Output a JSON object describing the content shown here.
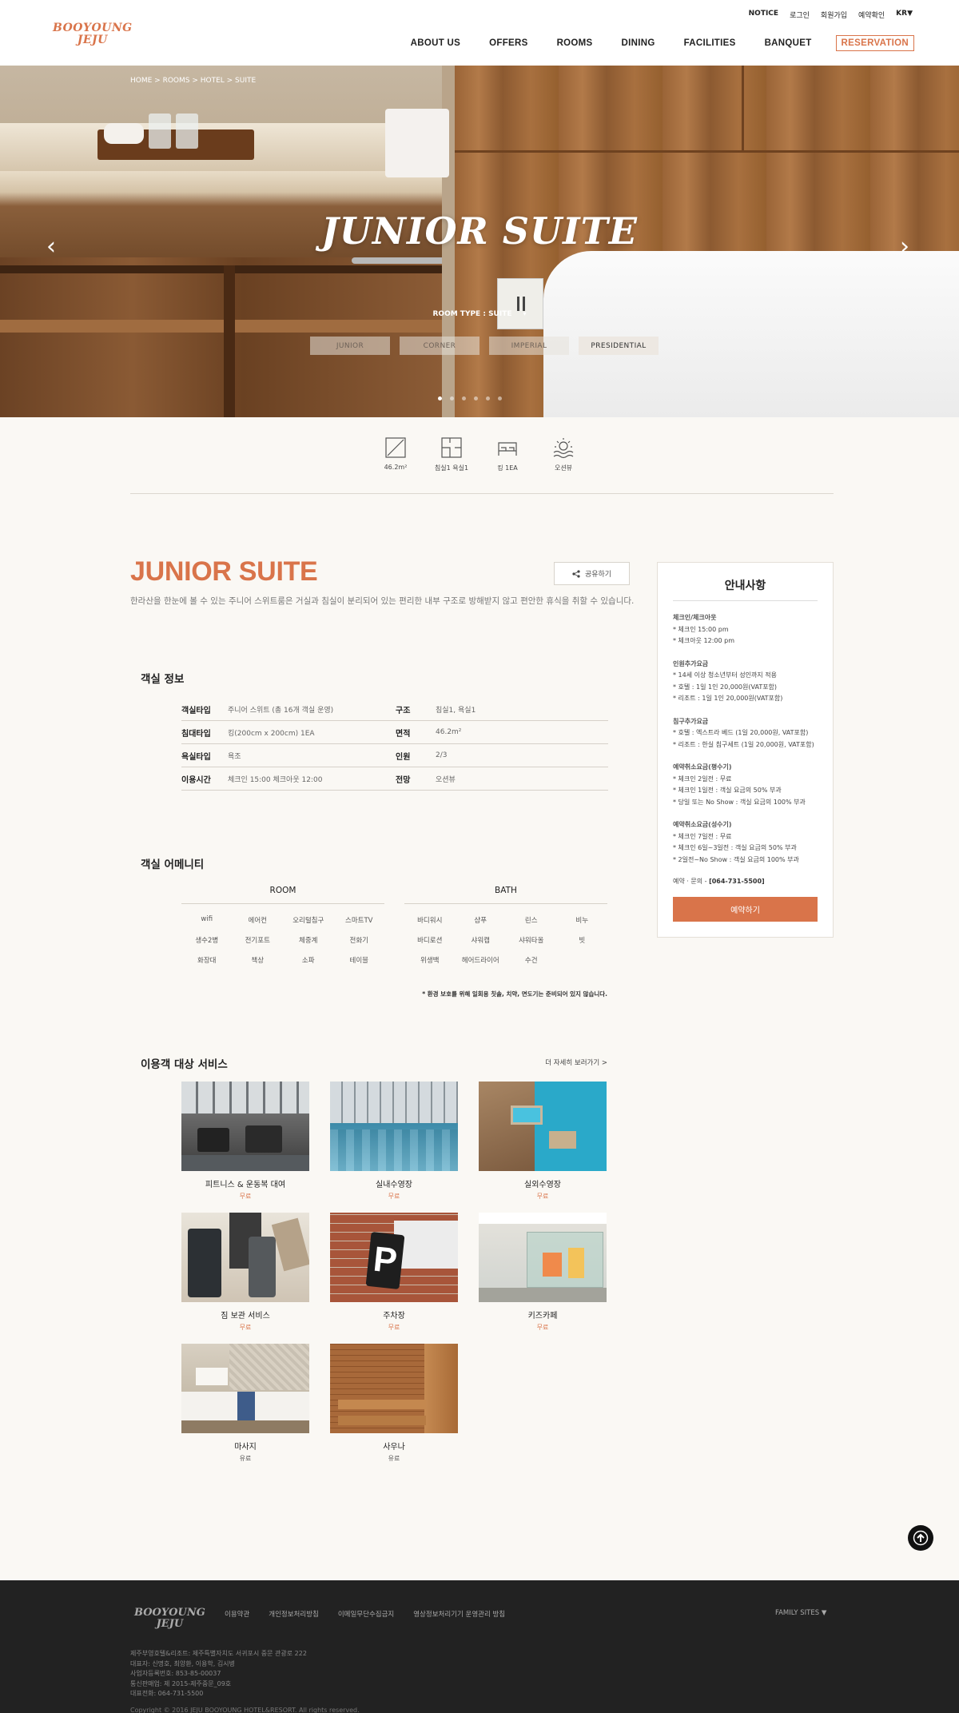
{
  "header": {
    "logo_line1": "BOOYOUNG",
    "logo_line2": "JEJU",
    "top_links": [
      "NOTICE",
      "로그인",
      "회원가입",
      "예약확인"
    ],
    "lang": "KR",
    "nav": [
      "ABOUT US",
      "OFFERS",
      "ROOMS",
      "DINING",
      "FACILITIES",
      "BANQUET"
    ],
    "reservation": "RESERVATION"
  },
  "hero": {
    "breadcrumb": "HOME > ROOMS > HOTEL > SUITE",
    "title": "JUNIOR SUITE",
    "room_type": "ROOM TYPE : SUITE",
    "tabs": [
      "JUNIOR",
      "CORNER",
      "IMPERIAL",
      "PRESIDENTIAL"
    ],
    "active_tab": "PRESIDENTIAL",
    "slide_count": 6,
    "active_slide": 1
  },
  "features": [
    {
      "icon": "area-icon",
      "label": "46.2m²"
    },
    {
      "icon": "floorplan-icon",
      "label": "침실1 욕실1"
    },
    {
      "icon": "bed-icon",
      "label": "킹 1EA"
    },
    {
      "icon": "ocean-view-icon",
      "label": "오션뷰"
    }
  ],
  "room": {
    "title": "JUNIOR SUITE",
    "description": "한라산을 한눈에 볼 수 있는 주니어 스위트룸은 거실과 침실이 분리되어 있는 편리한 내부 구조로 방해받지 않고 편안한 휴식을 취할 수 있습니다.",
    "share": "공유하기"
  },
  "room_info": {
    "title": "객실 정보",
    "rows": [
      {
        "k1": "객실타입",
        "v1": "주니어 스위트 (총 16개 객실 운영)",
        "k2": "구조",
        "v2": "침실1, 욕실1"
      },
      {
        "k1": "침대타입",
        "v1": "킹(200cm x 200cm) 1EA",
        "k2": "면적",
        "v2": "46.2m²"
      },
      {
        "k1": "욕실타입",
        "v1": "욕조",
        "k2": "인원",
        "v2": "2/3"
      },
      {
        "k1": "이용시간",
        "v1": "체크인 15:00 체크아웃 12:00",
        "k2": "전망",
        "v2": "오션뷰"
      }
    ]
  },
  "amenity": {
    "title": "객실 어메니티",
    "room_head": "ROOM",
    "room_items": [
      "wifi",
      "에어컨",
      "오리털침구",
      "스마트TV",
      "생수2병",
      "전기포트",
      "체중계",
      "전화기",
      "화장대",
      "책상",
      "소파",
      "테이블"
    ],
    "bath_head": "BATH",
    "bath_items": [
      "바디워시",
      "샴푸",
      "린스",
      "비누",
      "바디로션",
      "샤워캡",
      "샤워타올",
      "빗",
      "위생백",
      "헤어드라이어",
      "수건"
    ],
    "note": "* 환경 보호를 위해 일회용 칫솔, 치약, 면도기는 준비되어 있지 않습니다."
  },
  "services": {
    "title": "이용객 대상 서비스",
    "more": "더 자세히 보러가기 >",
    "items": [
      {
        "name": "피트니스 & 운동복 대여",
        "price": "무료"
      },
      {
        "name": "실내수영장",
        "price": "무료"
      },
      {
        "name": "실외수영장",
        "price": "무료"
      },
      {
        "name": "짐 보관 서비스",
        "price": "무료"
      },
      {
        "name": "주차장",
        "price": "무료"
      },
      {
        "name": "키즈카페",
        "price": "무료"
      },
      {
        "name": "마사지",
        "price": "유료"
      },
      {
        "name": "사우나",
        "price": "유료"
      }
    ]
  },
  "notice_panel": {
    "title": "안내사항",
    "sections": [
      {
        "head": "체크인/체크아웃",
        "lines": [
          "* 체크인 15:00 pm",
          "* 체크아웃 12:00 pm"
        ]
      },
      {
        "head": "인원추가요금",
        "lines": [
          "* 14세 이상 청소년부터 성인까지 적용",
          "* 호텔 : 1일 1인 20,000원(VAT포함)",
          "* 리조트 : 1일 1인 20,000원(VAT포함)"
        ]
      },
      {
        "head": "침구추가요금",
        "lines": [
          "* 호텔 : 엑스트라 베드 (1일 20,000원, VAT포함)",
          "* 리조트 : 한실 침구세트 (1일 20,000원, VAT포함)"
        ]
      },
      {
        "head": "예약취소요금(평수기)",
        "lines": [
          "* 체크인 2일전 : 무료",
          "* 체크인 1일전 : 객실 요금의 50% 부과",
          "* 당일 또는 No Show : 객실 요금의 100% 부과"
        ]
      },
      {
        "head": "예약취소요금(성수기)",
        "lines": [
          "* 체크인 7일전 : 무료",
          "* 체크인 6일~3일전 : 객실 요금의 50% 부과",
          "* 2일전~No Show : 객실 요금의 100% 부과"
        ]
      }
    ],
    "phone_label": "예약 · 문의",
    "phone": "[064-731-5500]",
    "button": "예약하기"
  },
  "footer": {
    "logo_line1": "BOOYOUNG",
    "logo_line2": "JEJU",
    "links": [
      "이용약관",
      "개인정보처리방침",
      "이메일무단수집금지",
      "영상정보처리기기 운영관리 방침"
    ],
    "family": "FAMILY SITES",
    "info": [
      "제주부영호텔&리조트: 제주특별자치도 서귀포시 중문 관광로 222",
      "대표자: 신명호, 최양환, 이용학, 김시병",
      "사업자등록번호: 853-85-00037",
      "통신판매업: 제 2015-제주중문_09호",
      "대표전화: 064-731-5500"
    ],
    "copyright": "Copyright © 2016 JEJU BOOYOUNG HOTEL&RESORT. All rights reserved."
  },
  "colors": {
    "accent": "#d9744a",
    "footer_bg": "#222222",
    "page_bg": "#faf8f4"
  }
}
